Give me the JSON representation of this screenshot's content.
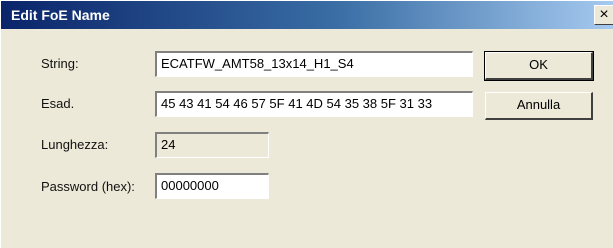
{
  "window": {
    "title": "Edit FoE Name",
    "close_label": "×"
  },
  "form": {
    "string_label": "String:",
    "string_value": "ECATFW_AMT58_13x14_H1_S4",
    "esad_label": "Esad.",
    "esad_value": "45 43 41 54 46 57 5F 41 4D 54 35 38 5F 31 33",
    "length_label": "Lunghezza:",
    "length_value": "24",
    "password_label": "Password (hex):",
    "password_value": "00000000"
  },
  "buttons": {
    "ok_label": "OK",
    "cancel_label": "Annulla"
  }
}
